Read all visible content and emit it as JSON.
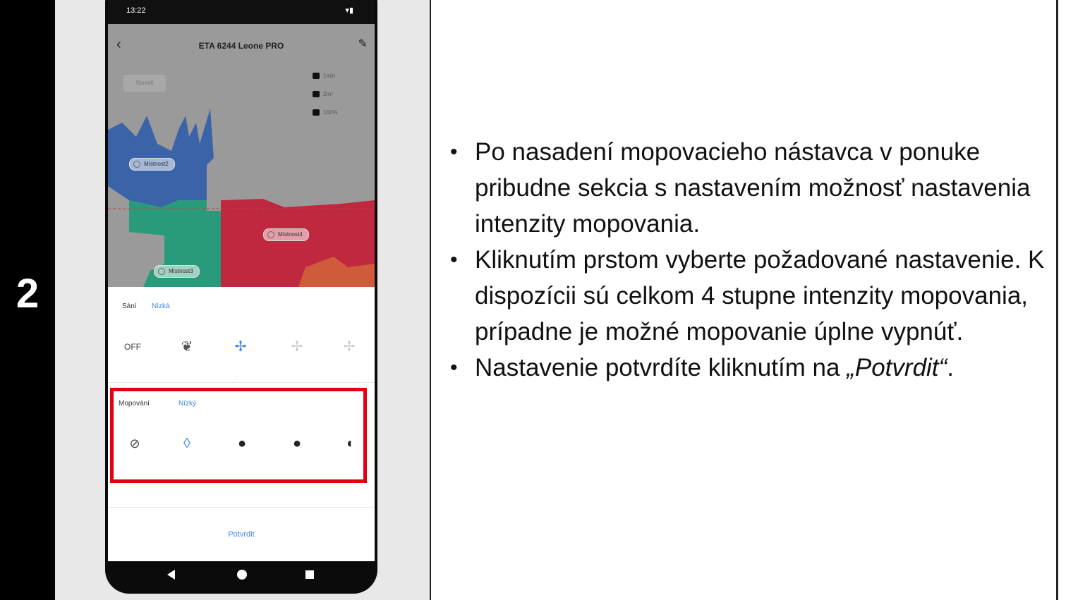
{
  "step": {
    "number": "2"
  },
  "phone": {
    "status_bar": {
      "time": "13:22",
      "indicators": "▾▮"
    },
    "app_bar": {
      "title": "ETA 6244 Leone PRO"
    },
    "map": {
      "clean_chip": "Spravit",
      "stats": [
        "1min",
        "2m²",
        "100%"
      ],
      "rooms": [
        "Místnost2",
        "Místnost4",
        "Místnost3"
      ],
      "colors": {
        "blue": "#3a63a8",
        "green": "#2a9b7a",
        "red": "#c0283f",
        "gray": "#9a9a9a"
      }
    },
    "suction": {
      "label": "Sání",
      "value": "Nízká",
      "options": [
        "OFF"
      ],
      "sub": "..."
    },
    "mopping": {
      "label": "Mopování",
      "value": "Nízký",
      "sub": "..."
    },
    "confirm_label": "Potvrdit",
    "accent_color": "#3f86e8",
    "highlight_color": "#e3000f"
  },
  "instructions": {
    "items": [
      "Po nasadení mopovacieho nástavca v ponuke pribudne sekcia s nastavením možnosť nastavenia intenzity mopovania.",
      "Kliknutím prstom vyberte požadované nastavenie. K dispozícii sú celkom 4 stupne intenzity mopovania, prípadne je možné mopovanie úplne vypnúť."
    ],
    "last_item_prefix": "Nastavenie potvrdíte kliknutím na ",
    "last_item_italic": "„Potvrdit“",
    "last_item_suffix": "."
  }
}
